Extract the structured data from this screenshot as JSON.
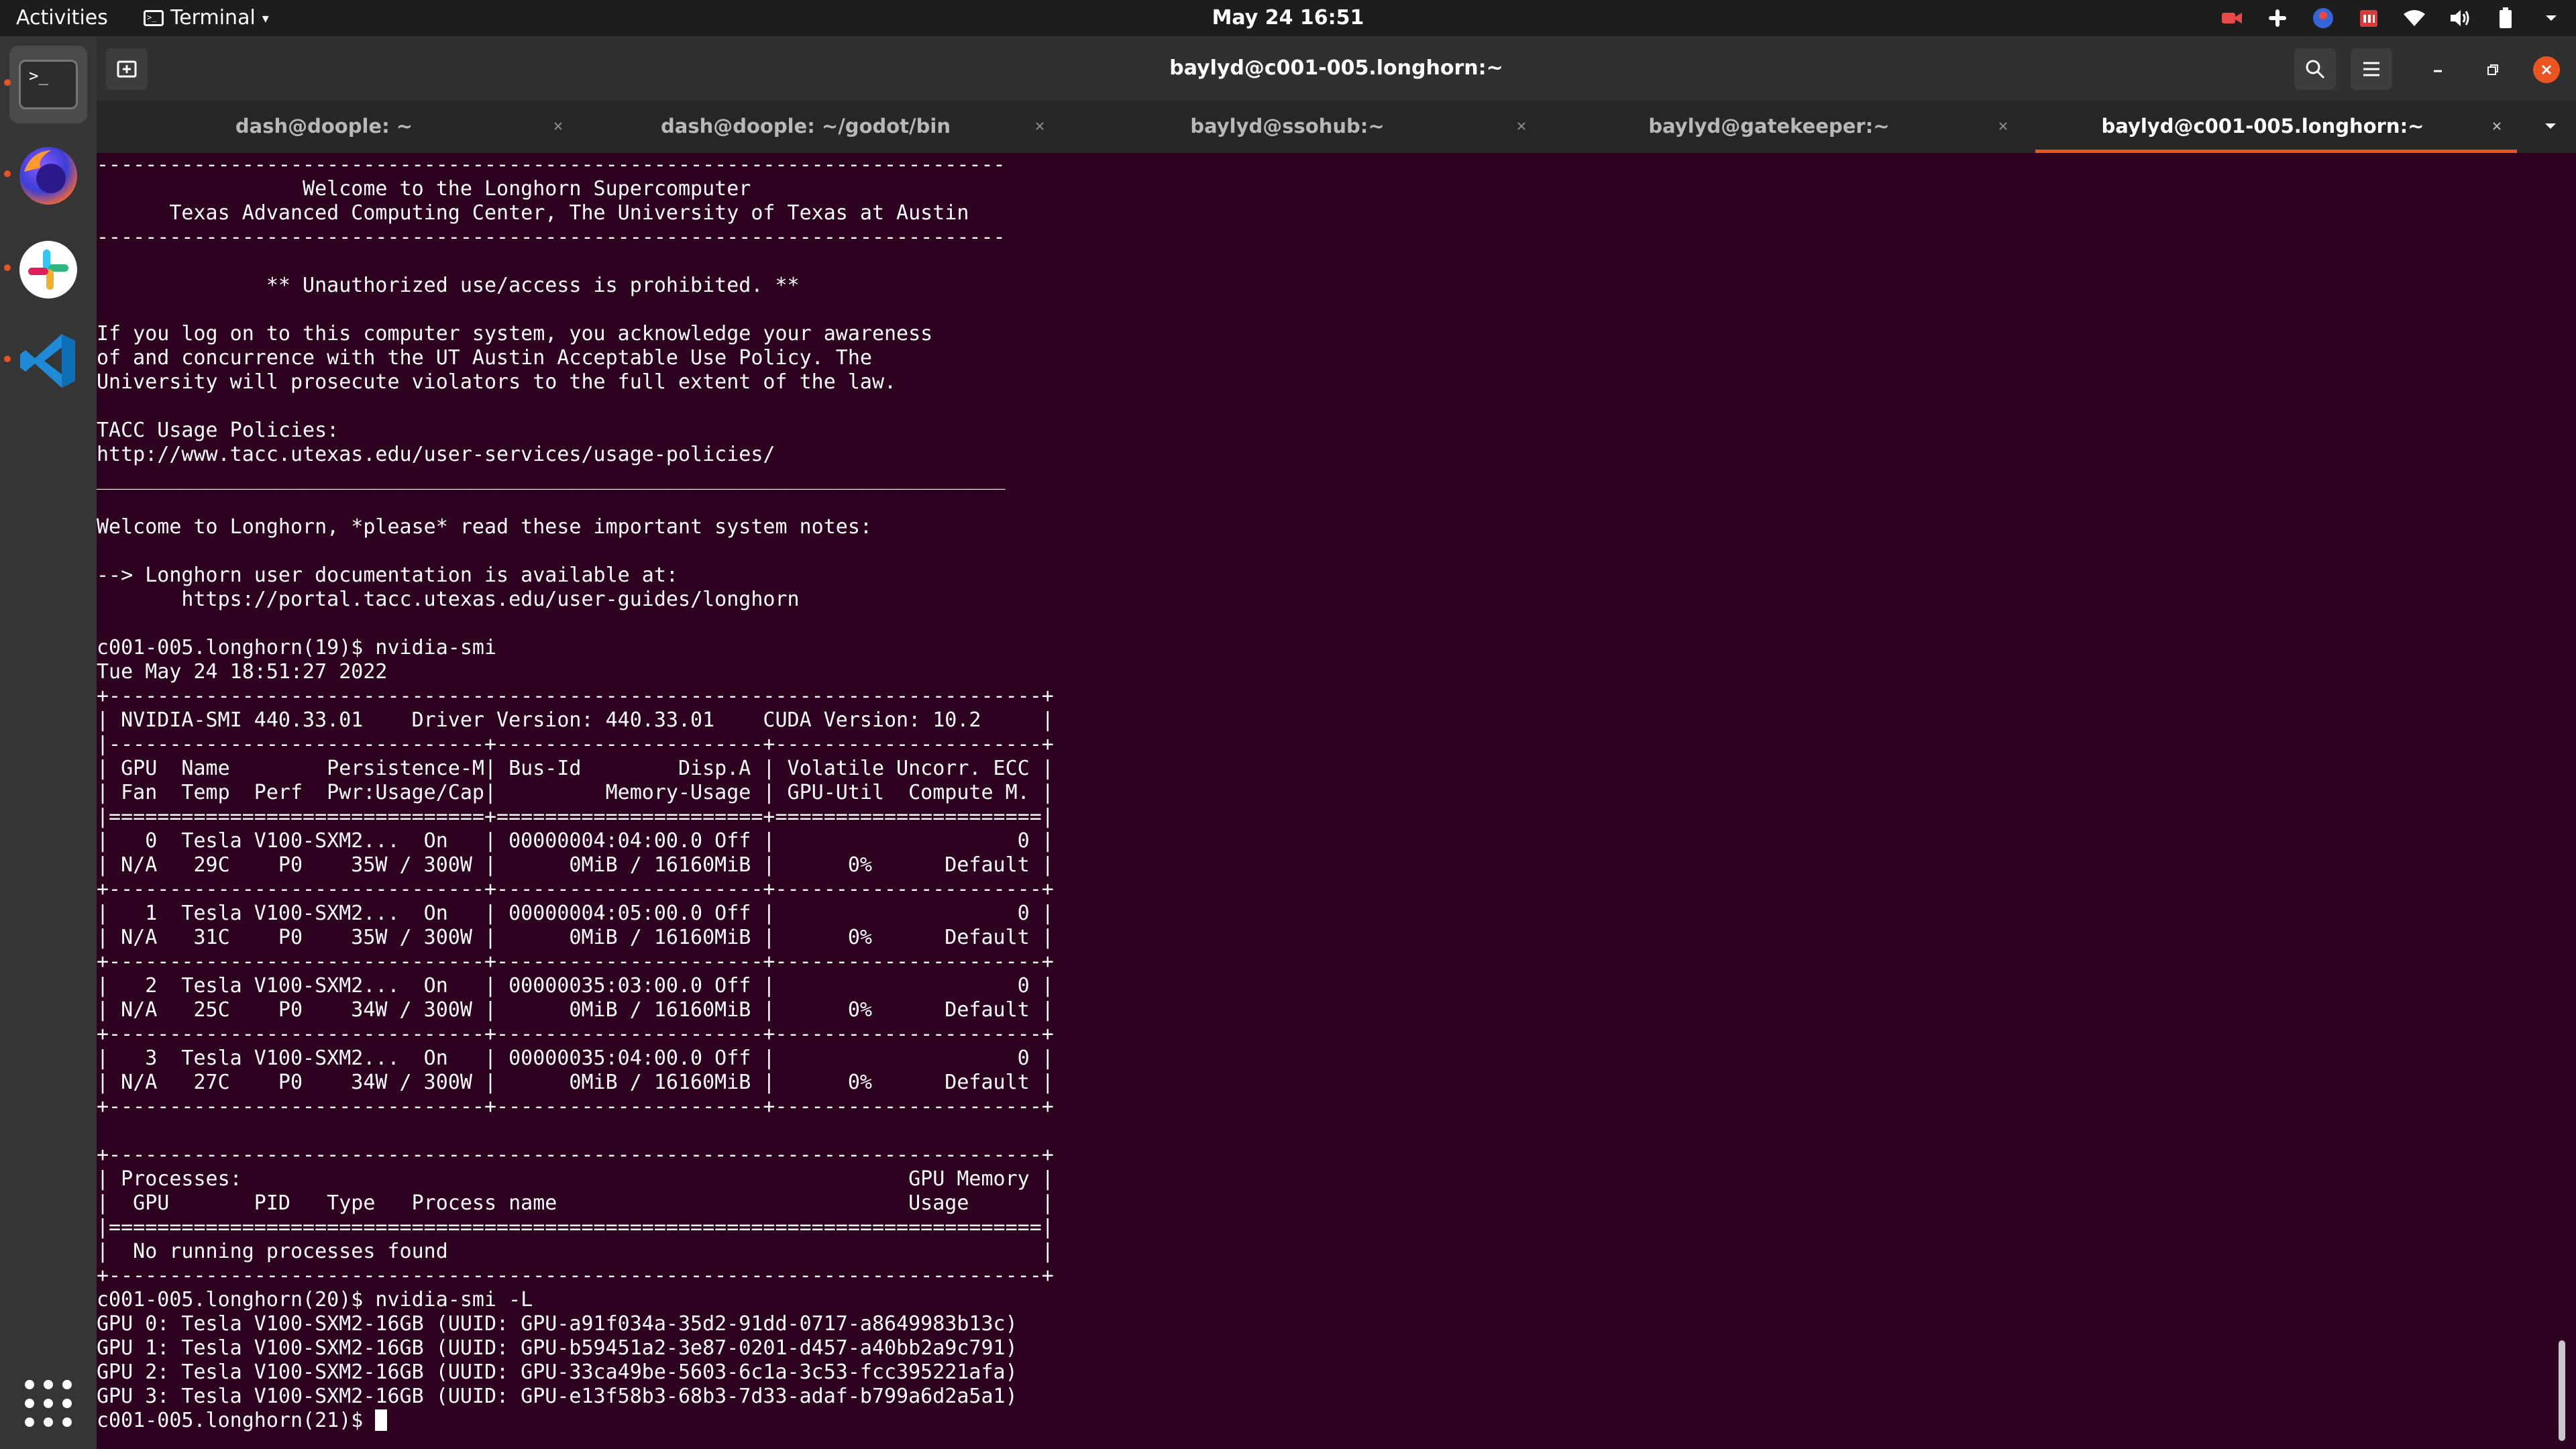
{
  "topbar": {
    "activities_label": "Activities",
    "app_menu_label": "Terminal",
    "clock": "May 24  16:51",
    "tray_icons": [
      "camera-icon",
      "slack-tray-icon",
      "app-tray-icon",
      "calendar-tray-icon",
      "wifi-icon",
      "volume-icon",
      "battery-icon",
      "chevron-down-icon"
    ]
  },
  "dock": {
    "items": [
      "terminal-app",
      "firefox-app",
      "slack-app",
      "vscode-app"
    ],
    "show_apps_label": "Show Applications"
  },
  "window": {
    "title": "baylyd@c001-005.longhorn:~",
    "tabs": [
      {
        "label": "dash@doople: ~"
      },
      {
        "label": "dash@doople: ~/godot/bin"
      },
      {
        "label": "baylyd@ssohub:~"
      },
      {
        "label": "baylyd@gatekeeper:~"
      },
      {
        "label": "baylyd@c001-005.longhorn:~"
      }
    ],
    "active_tab_index": 4
  },
  "terminal": {
    "lines": [
      "---------------------------------------------------------------------------",
      "                 Welcome to the Longhorn Supercomputer",
      "      Texas Advanced Computing Center, The University of Texas at Austin",
      "---------------------------------------------------------------------------",
      "",
      "              ** Unauthorized use/access is prohibited. **",
      "",
      "If you log on to this computer system, you acknowledge your awareness",
      "of and concurrence with the UT Austin Acceptable Use Policy. The",
      "University will prosecute violators to the full extent of the law.",
      "",
      "TACC Usage Policies:",
      "http://www.tacc.utexas.edu/user-services/usage-policies/",
      "___________________________________________________________________________",
      "",
      "Welcome to Longhorn, *please* read these important system notes:",
      "",
      "--> Longhorn user documentation is available at:",
      "       https://portal.tacc.utexas.edu/user-guides/longhorn",
      "",
      "c001-005.longhorn(19)$ nvidia-smi",
      "Tue May 24 18:51:27 2022",
      "+-----------------------------------------------------------------------------+",
      "| NVIDIA-SMI 440.33.01    Driver Version: 440.33.01    CUDA Version: 10.2     |",
      "|-------------------------------+----------------------+----------------------+",
      "| GPU  Name        Persistence-M| Bus-Id        Disp.A | Volatile Uncorr. ECC |",
      "| Fan  Temp  Perf  Pwr:Usage/Cap|         Memory-Usage | GPU-Util  Compute M. |",
      "|===============================+======================+======================|",
      "|   0  Tesla V100-SXM2...  On   | 00000004:04:00.0 Off |                    0 |",
      "| N/A   29C    P0    35W / 300W |      0MiB / 16160MiB |      0%      Default |",
      "+-------------------------------+----------------------+----------------------+",
      "|   1  Tesla V100-SXM2...  On   | 00000004:05:00.0 Off |                    0 |",
      "| N/A   31C    P0    35W / 300W |      0MiB / 16160MiB |      0%      Default |",
      "+-------------------------------+----------------------+----------------------+",
      "|   2  Tesla V100-SXM2...  On   | 00000035:03:00.0 Off |                    0 |",
      "| N/A   25C    P0    34W / 300W |      0MiB / 16160MiB |      0%      Default |",
      "+-------------------------------+----------------------+----------------------+",
      "|   3  Tesla V100-SXM2...  On   | 00000035:04:00.0 Off |                    0 |",
      "| N/A   27C    P0    34W / 300W |      0MiB / 16160MiB |      0%      Default |",
      "+-------------------------------+----------------------+----------------------+",
      "",
      "+-----------------------------------------------------------------------------+",
      "| Processes:                                                       GPU Memory |",
      "|  GPU       PID   Type   Process name                             Usage      |",
      "|=============================================================================|",
      "|  No running processes found                                                 |",
      "+-----------------------------------------------------------------------------+",
      "c001-005.longhorn(20)$ nvidia-smi -L",
      "GPU 0: Tesla V100-SXM2-16GB (UUID: GPU-a91f034a-35d2-91dd-0717-a8649983b13c)",
      "GPU 1: Tesla V100-SXM2-16GB (UUID: GPU-b59451a2-3e87-0201-d457-a40bb2a9c791)",
      "GPU 2: Tesla V100-SXM2-16GB (UUID: GPU-33ca49be-5603-6c1a-3c53-fcc395221afa)",
      "GPU 3: Tesla V100-SXM2-16GB (UUID: GPU-e13f58b3-68b3-7d33-adaf-b799a6d2a5a1)"
    ],
    "prompt": "c001-005.longhorn(21)$ "
  },
  "colors": {
    "terminal_bg": "#2c001e",
    "accent": "#e95420",
    "close_button": "#e95420"
  }
}
